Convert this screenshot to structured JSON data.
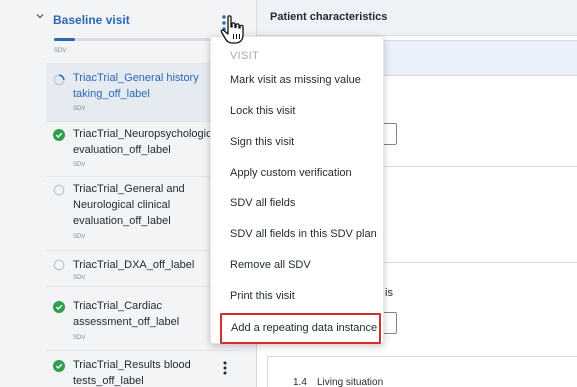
{
  "visit": {
    "title": "Baseline visit",
    "sdv_label": "SDV",
    "progress": 0.12,
    "accent_color": "#2c67b5"
  },
  "forms": [
    {
      "label": "TriacTrial_General history taking_off_label",
      "sdv": "SDV",
      "status": "in-progress",
      "active": true
    },
    {
      "label": "TriacTrial_Neuropsychological evaluation_off_label",
      "sdv": "SDV",
      "status": "complete",
      "active": false
    },
    {
      "label": "TriacTrial_General and Neurological clinical evaluation_off_label",
      "sdv": "SDV",
      "status": "empty",
      "active": false
    },
    {
      "label": "TriacTrial_DXA_off_label",
      "sdv": "SDV",
      "status": "empty",
      "active": false
    },
    {
      "label": "TriacTrial_Cardiac assessment_off_label",
      "sdv": "SDV",
      "status": "complete",
      "active": false
    },
    {
      "label": "TriacTrial_Results blood tests_off_label",
      "sdv": "SDV",
      "status": "complete",
      "active": false
    }
  ],
  "content": {
    "section_title": "Patient characteristics",
    "partial_label": "is",
    "subsection_number": "1.4",
    "subsection_title": "Living situation"
  },
  "menu": {
    "heading": "VISIT",
    "items": [
      "Mark visit as missing value",
      "Lock this visit",
      "Sign this visit",
      "Apply custom verification",
      "SDV all fields",
      "SDV all fields in this SDV plan",
      "Remove all SDV",
      "Print this visit",
      "Add a repeating data instance"
    ],
    "highlight_color": "#d32f2f"
  },
  "icons": {
    "collapse": "chevron-down-icon",
    "more": "kebab-menu-icon",
    "complete": "check-circle-icon",
    "empty": "empty-circle-icon",
    "in_progress": "progress-circle-icon",
    "cursor": "hand-pointer-icon"
  }
}
